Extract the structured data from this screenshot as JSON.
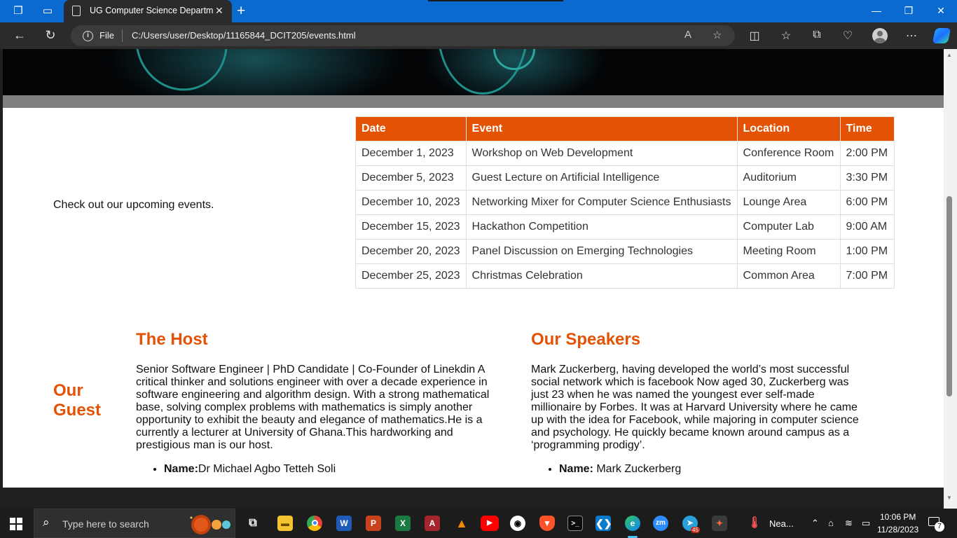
{
  "browser": {
    "tab_title": "UG Computer Science Departme",
    "url_scheme": "File",
    "url": "C:/Users/user/Desktop/11165844_DCIT205/events.html"
  },
  "page": {
    "intro": "Check out our upcoming events.",
    "events_table": {
      "headers": [
        "Date",
        "Event",
        "Location",
        "Time"
      ],
      "rows": [
        [
          "December 1, 2023",
          "Workshop on Web Development",
          "Conference Room",
          "2:00 PM"
        ],
        [
          "December 5, 2023",
          "Guest Lecture on Artificial Intelligence",
          "Auditorium",
          "3:30 PM"
        ],
        [
          "December 10, 2023",
          "Networking Mixer for Computer Science Enthusiasts",
          "Lounge Area",
          "6:00 PM"
        ],
        [
          "December 15, 2023",
          "Hackathon Competition",
          "Computer Lab",
          "9:00 AM"
        ],
        [
          "December 20, 2023",
          "Panel Discussion on Emerging Technologies",
          "Meeting Room",
          "1:00 PM"
        ],
        [
          "December 25, 2023",
          "Christmas Celebration",
          "Common Area",
          "7:00 PM"
        ]
      ]
    },
    "guest_heading": "Our Guest",
    "host": {
      "heading": "The Host",
      "bio": "Senior Software Engineer | PhD Candidate | Co-Founder of Linekdin A critical thinker and solutions engineer with over a decade experience in software engineering and algorithm design. With a strong mathematical base, solving complex problems with mathematics is simply another opportunity to exhibit the beauty and elegance of mathematics.He is a currently a lecturer at University of Ghana.This hardworking and prestigious man is our host.",
      "name_label": "Name:",
      "name_value": "Dr Michael Agbo Tetteh Soli"
    },
    "speakers": {
      "heading": "Our Speakers",
      "bio": "Mark Zuckerberg, having developed the world’s most successful social network which is facebook Now aged 30, Zuckerberg was just 23 when he was named the youngest ever self-made millionaire by Forbes. It was at Harvard University where he came up with the idea for Facebook, while majoring in computer science and psychology. He quickly became known around campus as a ‘programming prodigy’.",
      "name_label": "Name:",
      "name_value": " Mark Zuckerberg"
    }
  },
  "taskbar": {
    "search_placeholder": "Type here to search",
    "weather_text": "Nea...",
    "time": "10:06 PM",
    "date": "11/28/2023",
    "telegram_badge": "45",
    "notification_count": "7"
  },
  "colors": {
    "accent_orange": "#e35205",
    "title_bar_blue": "#0a6ad0"
  }
}
